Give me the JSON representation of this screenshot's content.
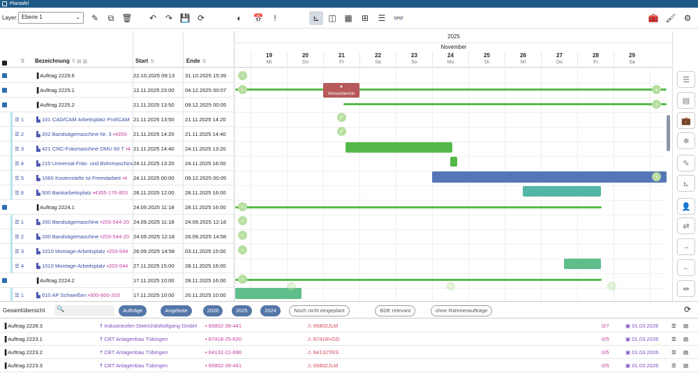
{
  "app": {
    "title": "Plantafel"
  },
  "toolbar": {
    "layer_label": "Layer:",
    "layer_value": "Ebene 1"
  },
  "table": {
    "headers": {
      "name": "Bezeichnung",
      "start": "Start",
      "end": "Ende"
    },
    "rows": [
      {
        "expand": true,
        "num": "",
        "name": "Auftrag 2229.6",
        "pink": "",
        "start": "22.10.2025 09:13",
        "end": "31.10.2025 15:39",
        "sub": false
      },
      {
        "expand": true,
        "num": "",
        "name": "Auftrag 2225.1",
        "pink": "",
        "start": "12.11.2025 23:00",
        "end": "04.12.2025 00:07",
        "sub": false
      },
      {
        "expand": true,
        "num": "",
        "name": "Auftrag 2225.2",
        "pink": "",
        "start": "21.11.2025 13:50",
        "end": "09.12.2025 00:05",
        "sub": false
      },
      {
        "expand": false,
        "num": "1",
        "name": "101 CAD/CAM Arbeitsplatz ProfiCAM",
        "pink": "",
        "start": "21.11.2025 13:50",
        "end": "21.11.2025 14:20",
        "sub": true
      },
      {
        "expand": false,
        "num": "2",
        "name": "202 Bandsägemaschine Nr. 3",
        "pink": "4355-",
        "start": "21.11.2025 14:20",
        "end": "21.11.2025 14:40",
        "sub": true
      },
      {
        "expand": false,
        "num": "3",
        "name": "421 CNC-Fräsmaschine DMU 60 T",
        "pink": "4",
        "start": "21.11.2025 14:40",
        "end": "24.11.2025 13:20",
        "sub": true
      },
      {
        "expand": false,
        "num": "4",
        "name": "210 Universal-Fräs- und Bohrmaschine",
        "pink": "",
        "start": "24.11.2025 13:20",
        "end": "24.11.2025 16:00",
        "sub": true
      },
      {
        "expand": false,
        "num": "5",
        "name": "1060 Kostenstelle ist Fremdarbeit",
        "pink": "4",
        "start": "24.11.2025 00:00",
        "end": "09.12.2025 00:05",
        "sub": true
      },
      {
        "expand": false,
        "num": "6",
        "name": "500 Bankarbeitsplatz",
        "pink": "4355-170-853",
        "start": "26.11.2025 12:00",
        "end": "28.11.2025 16:00",
        "sub": true
      },
      {
        "expand": true,
        "num": "",
        "name": "Auftrag 2224.1",
        "pink": "",
        "start": "24.09.2025 11:18",
        "end": "28.11.2025 16:00",
        "sub": false
      },
      {
        "expand": false,
        "num": "1",
        "name": "200 Bandsägemaschine",
        "pink": "203-544-20",
        "start": "24.09.2025 11:18",
        "end": "24.09.2025 12:18",
        "sub": true
      },
      {
        "expand": false,
        "num": "2",
        "name": "200 Bandsägemaschine",
        "pink": "203-544-20",
        "start": "24.09.2025 12:18",
        "end": "26.09.2025 14:58",
        "sub": true
      },
      {
        "expand": false,
        "num": "3",
        "name": "1010 Montage-Arbeitsplatz",
        "pink": "203-544",
        "start": "26.09.2025 14:58",
        "end": "03.11.2025 15:00",
        "sub": true
      },
      {
        "expand": false,
        "num": "4",
        "name": "1010 Montage-Arbeitsplatz",
        "pink": "203-544",
        "start": "27.11.2025 15:00",
        "end": "28.11.2025 16:00",
        "sub": true
      },
      {
        "expand": true,
        "num": "",
        "name": "Auftrag 2224.2",
        "pink": "",
        "start": "17.11.2025 10:00",
        "end": "28.11.2025 16:00",
        "sub": false
      },
      {
        "expand": false,
        "num": "1",
        "name": "610 AP Schweißen",
        "pink": "300-600-203",
        "start": "17.11.2025 10:00",
        "end": "20.11.2025 10:00",
        "sub": true
      }
    ]
  },
  "gantt": {
    "year": "2025",
    "month": "November",
    "days": [
      {
        "d": "19",
        "w": "Mi"
      },
      {
        "d": "20",
        "w": "Do"
      },
      {
        "d": "21",
        "w": "Fr"
      },
      {
        "d": "22",
        "w": "Sa"
      },
      {
        "d": "23",
        "w": "So"
      },
      {
        "d": "24",
        "w": "Mo"
      },
      {
        "d": "25",
        "w": "Di"
      },
      {
        "d": "26",
        "w": "Mi"
      },
      {
        "d": "27",
        "w": "Do"
      },
      {
        "d": "28",
        "w": "Fr"
      },
      {
        "d": "29",
        "w": "Sa"
      }
    ],
    "wunschtermin": "Wunschtermin",
    "colors": {
      "green": "#55b94a",
      "blue": "#5576b6",
      "teal": "#53b5a6",
      "red": "#b7585a",
      "mint": "#5fbd8c"
    }
  },
  "bottom": {
    "title": "Gesamtübersicht",
    "filters": [
      {
        "label": "Aufträge",
        "on": true
      },
      {
        "label": "Angebote",
        "on": true
      },
      {
        "label": "2026",
        "on": true
      },
      {
        "label": "2025",
        "on": true
      },
      {
        "label": "2024",
        "on": true
      },
      {
        "label": "Noch nicht eingeplant",
        "on": false
      },
      {
        "label": "BDE relevant",
        "on": false
      },
      {
        "label": "ohne Rahmenaufträge",
        "on": false
      }
    ],
    "rows": [
      {
        "name": "Auftrag 2228.3",
        "customer": "Industrieofen Dietrich&Wolfgang GmbH",
        "article": "65802-26-441",
        "draw": "65802JLM",
        "count": "0/7",
        "date": "01.03.2026"
      },
      {
        "name": "Auftrag 2223.1",
        "customer": "CBT Anlagenbau Tübingen",
        "article": "87418-25-620",
        "draw": "87418VGD",
        "count": "0/5",
        "date": "01.03.2026"
      },
      {
        "name": "Auftrag 2223.2",
        "customer": "CBT Anlagenbau Tübingen",
        "article": "84132-22-690",
        "draw": "84132TRS",
        "count": "0/5",
        "date": "01.03.2026"
      },
      {
        "name": "Auftrag 2223.3",
        "customer": "CBT Anlagenbau Tübingen",
        "article": "65802-26-441",
        "draw": "65802JLM",
        "count": "0/5",
        "date": "01.03.2026"
      }
    ]
  }
}
